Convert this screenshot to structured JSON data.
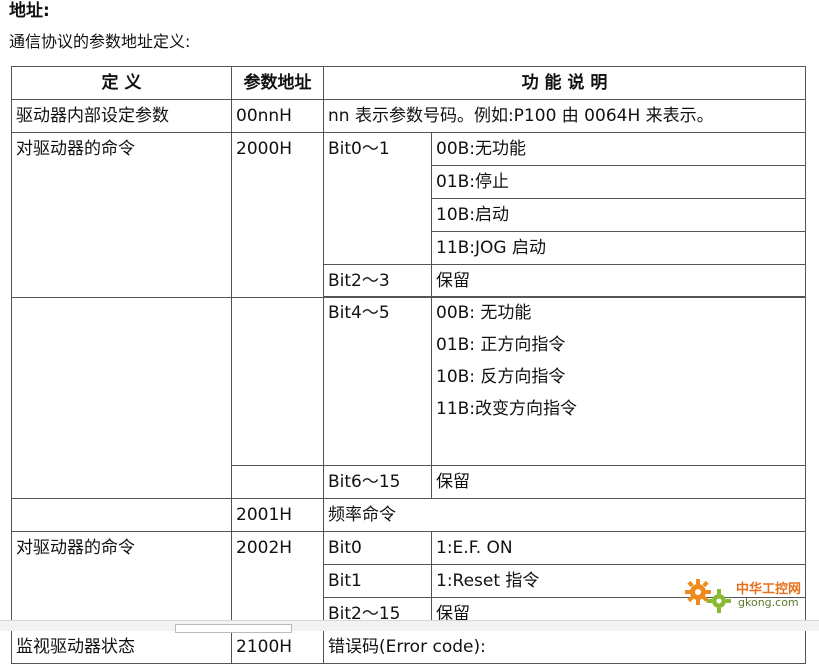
{
  "heading": "地址:",
  "intro": "通信协议的参数地址定义:",
  "table": {
    "headers": [
      "定  义",
      "参数地址",
      "功 能 说 明"
    ],
    "row1": {
      "def": "驱动器内部设定参数",
      "addr": "00nnH",
      "desc": "nn 表示参数号码。例如:P100  由 0064H 来表示。"
    },
    "group1": {
      "def": "对驱动器的命令",
      "addr": "2000H",
      "bit01": {
        "bit": "Bit0～1",
        "values": [
          "00B:无功能",
          "01B:停止",
          "10B:启动",
          "11B:JOG 启动"
        ]
      },
      "bit23": {
        "bit": "Bit2～3",
        "value": "保留"
      },
      "bit45": {
        "bit": "Bit4～5",
        "values": [
          "00B:  无功能",
          "01B:  正方向指令",
          "10B:  反方向指令",
          "11B:改变方向指令"
        ]
      },
      "bit615": {
        "bit": "Bit6～15",
        "value": "保留"
      },
      "addr2": "2001H",
      "freq": "频率命令"
    },
    "group2": {
      "def": "对驱动器的命令",
      "addr": "2002H",
      "rows": [
        {
          "bit": "Bit0",
          "value": "1:E.F. ON"
        },
        {
          "bit": "Bit1",
          "value": "1:Reset 指令"
        },
        {
          "bit": "Bit2～15",
          "value": "保留"
        }
      ]
    },
    "group3": {
      "def": "监视驱动器状态",
      "addr": "2100H",
      "desc": "错误码(Error code):"
    }
  },
  "watermark": {
    "cn": "中华工控网",
    "en": "gkong.com"
  }
}
